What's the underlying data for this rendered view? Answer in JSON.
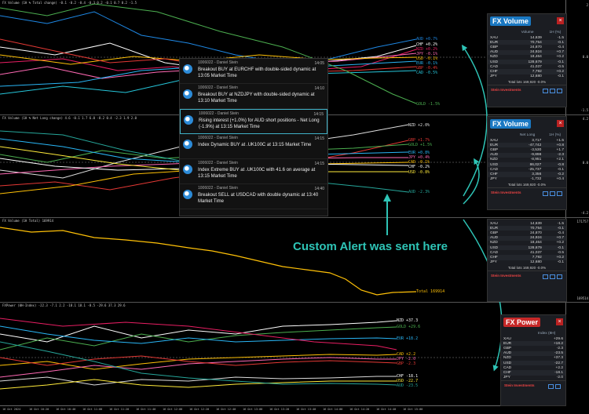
{
  "panes": [
    {
      "title": "FX Volume (1H % Total change)  -0.1 -0.2 -0.4 -0.3 0.2 -0.1 0.7 0.2 -1.5",
      "axis": [
        "2",
        "0.0",
        "-1.5"
      ],
      "series": [
        {
          "label": "AUD +0.7%",
          "color": "#1e88e5"
        },
        {
          "label": "CHF +0.2%",
          "color": "#ffffff"
        },
        {
          "label": "NZD +0.2%",
          "color": "#e91e63"
        },
        {
          "label": "JPY -0.1%",
          "color": "#ff69b4"
        },
        {
          "label": "USD -0.1%",
          "color": "#ffc107"
        },
        {
          "label": "EUR -0.1%",
          "color": "#29b6f6"
        },
        {
          "label": "GBP -0.4%",
          "color": "#e53935"
        },
        {
          "label": "CAD -0.5%",
          "color": "#26c6da"
        },
        {
          "label": "GOLD -1.5%",
          "color": "#4caf50"
        }
      ]
    },
    {
      "title": "FX Volume (1H % Net Long change)  4.6 -0.1 1.7 6.0 -8.2 0.4 -2.3 1.9 2.0",
      "axis": [
        "4.2",
        "0.0",
        "-4.2"
      ],
      "series": [
        {
          "label": "NZD +2.0%",
          "color": "#e0e0e0"
        },
        {
          "label": "GBP +1.7%",
          "color": "#e53935"
        },
        {
          "label": "GOLD +1.5%",
          "color": "#4caf50"
        },
        {
          "label": "EUR +0.8%",
          "color": "#29b6f6"
        },
        {
          "label": "JPY +0.4%",
          "color": "#ff69b4"
        },
        {
          "label": "CAD -0.1%",
          "color": "#ffc107"
        },
        {
          "label": "CHF -0.2%",
          "color": "#ffffff"
        },
        {
          "label": "USD -0.8%",
          "color": "#ffeb3b"
        },
        {
          "label": "AUD -2.3%",
          "color": "#26a69a"
        }
      ]
    },
    {
      "title": "FX Volume (1H Total)  169914",
      "axis": [
        "171757",
        "169514"
      ],
      "series": [
        {
          "label": "Total 169914",
          "color": "#ffc107"
        }
      ]
    },
    {
      "title": "FXPower (0H-Index)  -22.3 -7.1 2.2 -18.1 18.1 -8.5 -29.6 37.3 29.6",
      "axis": [
        "",
        ""
      ],
      "series": [
        {
          "label": "NZD +37.3",
          "color": "#ffffff"
        },
        {
          "label": "GOLD +29.6",
          "color": "#4caf50"
        },
        {
          "label": "EUR +18.2",
          "color": "#29b6f6"
        },
        {
          "label": "CAD +2.2",
          "color": "#ffc107"
        },
        {
          "label": "JPY -2.0",
          "color": "#ff69b4"
        },
        {
          "label": "GBP -2.3",
          "color": "#e53935"
        },
        {
          "label": "CHF -18.1",
          "color": "#ffffff"
        },
        {
          "label": "USD -22.7",
          "color": "#ffeb3b"
        },
        {
          "label": "AUD -23.5",
          "color": "#26a69a"
        }
      ]
    }
  ],
  "time_axis": [
    "16 Oct 2024",
    "16 Oct 10:20",
    "16 Oct 10:40",
    "16 Oct 11:00",
    "16 Oct 11:20",
    "16 Oct 11:40",
    "16 Oct 12:00",
    "16 Oct 12:20",
    "16 Oct 12:40",
    "16 Oct 13:00",
    "16 Oct 13:20",
    "16 Oct 13:40",
    "16 Oct 14:00",
    "16 Oct 14:20",
    "16 Oct 14:40",
    "16 Oct 15:00"
  ],
  "alerts": [
    {
      "from": "1006022 - Daniel Stein",
      "time": "14:05",
      "msg": "Breakout BUY at EURCHF with double-sided dynamic at 13:05 Market Time"
    },
    {
      "from": "1006022 - Daniel Stein",
      "time": "14:10",
      "msg": "Breakout BUY at NZDJPY with double-sided dynamic at 13:10 Market Time"
    },
    {
      "from": "1006022 - Daniel Stein",
      "time": "14:15",
      "msg": "Rising interest (+1.0%) for AUD short positions - Net Long (-1.9%) at 13:15 Market Time"
    },
    {
      "from": "1006022 - Daniel Stein",
      "time": "14:15",
      "msg": "Index Dynamic BUY at .UK100C at 13:15 Market Time"
    },
    {
      "from": "1006022 - Daniel Stein",
      "time": "14:15",
      "msg": "Index Extreme BUY at .UK100C with 41.6 on average at 13:15 Market Time"
    },
    {
      "from": "1006022 - Daniel Stein",
      "time": "14:40",
      "msg": "Breakout SELL at USDCAD with double dynamic at 13:40 Market Time"
    }
  ],
  "callout": "Custom Alert was sent here",
  "panel_volume1": {
    "logo": "FX Volume",
    "headers": [
      "Volume",
      "1H (%)"
    ],
    "rows": [
      [
        "XAU",
        "14,639",
        "-1.5"
      ],
      [
        "EUR",
        "70,754",
        "-0.1"
      ],
      [
        "GBP",
        "24,870",
        "-0.4"
      ],
      [
        "AUD",
        "24,924",
        "+0.7"
      ],
      [
        "NZD",
        "18,464",
        "+0.2"
      ],
      [
        "USD",
        "128,679",
        "-0.1"
      ],
      [
        "CAD",
        "41,037",
        "-0.5"
      ],
      [
        "CHF",
        "7,792",
        "+0.2"
      ],
      [
        "JPY",
        "12,680",
        "-0.1"
      ]
    ],
    "total": "Total lots 169,920 -0.0%",
    "brand": "Stein Investments"
  },
  "panel_volume2": {
    "logo": "FX Volume",
    "headers": [
      "Net Long",
      "1H (%)"
    ],
    "rows": [
      [
        "XAU",
        "3,717",
        "+1.5"
      ],
      [
        "EUR",
        "-47,742",
        "+0.8"
      ],
      [
        "GBP",
        "-3,530",
        "+1.7"
      ],
      [
        "AUD",
        "-9,898",
        "-2.3"
      ],
      [
        "NZD",
        "-8,951",
        "+2.1"
      ],
      [
        "USD",
        "86,027",
        "-0.8"
      ],
      [
        "CAD",
        "-25,737",
        "-0.1"
      ],
      [
        "CHF",
        "3,356",
        "-0.2"
      ],
      [
        "JPY",
        "-1,732",
        "+0.4"
      ]
    ],
    "total": "Total lots 169,920 -0.0%",
    "brand": "Stein Investments"
  },
  "panel_volume3": {
    "rows": [
      [
        "XAU",
        "14,639",
        "-1.5"
      ],
      [
        "EUR",
        "70,754",
        "-0.1"
      ],
      [
        "GBP",
        "24,870",
        "-0.4"
      ],
      [
        "AUD",
        "24,924",
        "+0.7"
      ],
      [
        "NZD",
        "18,464",
        "+0.2"
      ],
      [
        "USD",
        "128,679",
        "-0.1"
      ],
      [
        "CAD",
        "41,037",
        "-0.5"
      ],
      [
        "CHF",
        "7,792",
        "+0.2"
      ],
      [
        "JPY",
        "12,680",
        "-0.1"
      ]
    ],
    "total": "Total lots 169,920 -0.0%",
    "brand": "Stein Investments"
  },
  "panel_power": {
    "logo": "FX Power",
    "headers": [
      "Index (8H)"
    ],
    "rows": [
      [
        "XAU",
        "+29.6"
      ],
      [
        "EUR",
        "+18.2"
      ],
      [
        "GBP",
        "-2.3"
      ],
      [
        "AUD",
        "-23.5"
      ],
      [
        "NZD",
        "+37.3"
      ],
      [
        "USD",
        "-22.7"
      ],
      [
        "CAD",
        "+2.2"
      ],
      [
        "CHF",
        "-18.1"
      ],
      [
        "JPY",
        "-2.0"
      ]
    ],
    "brand": "Stein Investments"
  }
}
